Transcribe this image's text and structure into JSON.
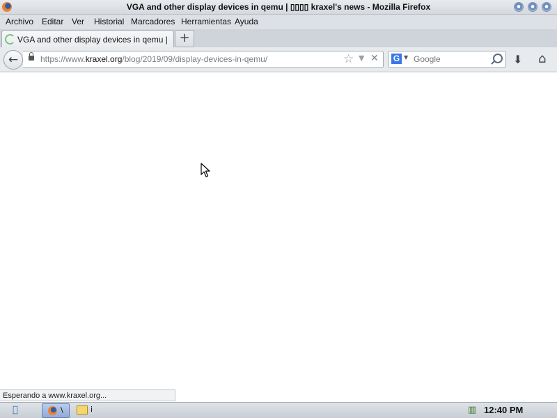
{
  "window": {
    "title": "VGA and other display devices in qemu | ▯▯▯▯ kraxel's news - Mozilla Firefox",
    "app_icon": "firefox-icon"
  },
  "menubar": {
    "items": [
      {
        "label": "Archivo",
        "accel": "A"
      },
      {
        "label": "Editar",
        "accel": "E"
      },
      {
        "label": "Ver",
        "accel": "V"
      },
      {
        "label": "Historial",
        "accel": "H"
      },
      {
        "label": "Marcadores",
        "accel": "M"
      },
      {
        "label": "Herramientas",
        "accel": "H"
      },
      {
        "label": "Ayuda",
        "accel": "y"
      }
    ]
  },
  "tabs": [
    {
      "label": "VGA and other display devices in qemu | □…",
      "loading": true
    }
  ],
  "newtab_symbol": "+",
  "navbar": {
    "url_prefix": "https://www.",
    "url_host": "kraxel.org",
    "url_path": "/blog/2019/09/display-devices-in-qemu/",
    "search_placeholder": "Google",
    "search_engine": "G"
  },
  "statusbar": {
    "text": "Esperando a www.kraxel.org..."
  },
  "taskbar": {
    "task_firefox_label": "\\",
    "task_folder_label": "i",
    "clock": "12:40 PM"
  },
  "colors": {
    "accent": "#3b78e7",
    "spinner": "#7cc37c",
    "title_bar": "#dde1e6"
  }
}
